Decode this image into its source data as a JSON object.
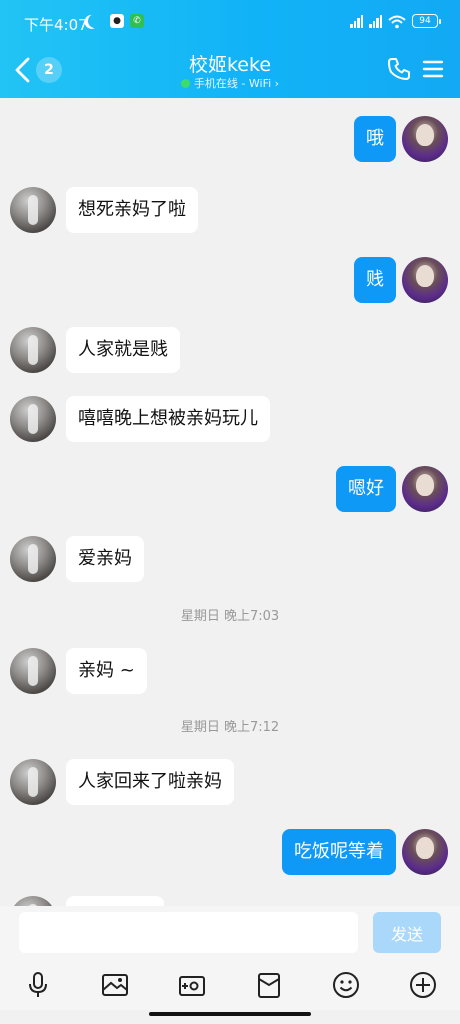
{
  "status_bar": {
    "time": "下午4:07",
    "battery": "94"
  },
  "header": {
    "unread_count": "2",
    "title": "校姬keke",
    "status_text": "手机在线 - WiFi ›"
  },
  "messages": [
    {
      "side": "out",
      "text": "哦"
    },
    {
      "side": "in",
      "text": "想死亲妈了啦"
    },
    {
      "side": "out",
      "text": "贱"
    },
    {
      "side": "in",
      "text": "人家就是贱"
    },
    {
      "side": "in",
      "text": "嘻嘻晚上想被亲妈玩儿"
    },
    {
      "side": "out",
      "text": "嗯好"
    },
    {
      "side": "in",
      "text": "爱亲妈"
    },
    {
      "type": "time",
      "text": "星期日 晚上7:03"
    },
    {
      "side": "in",
      "text": "亲妈 ~"
    },
    {
      "type": "time",
      "text": "星期日 晚上7:12"
    },
    {
      "side": "in",
      "text": "人家回来了啦亲妈"
    },
    {
      "side": "out",
      "text": "吃饭呢等着"
    }
  ],
  "input": {
    "send_label": "发送"
  },
  "toolbar": [
    "mic-icon",
    "image-icon",
    "camera-icon",
    "red-packet-icon",
    "emoji-icon",
    "plus-icon"
  ]
}
